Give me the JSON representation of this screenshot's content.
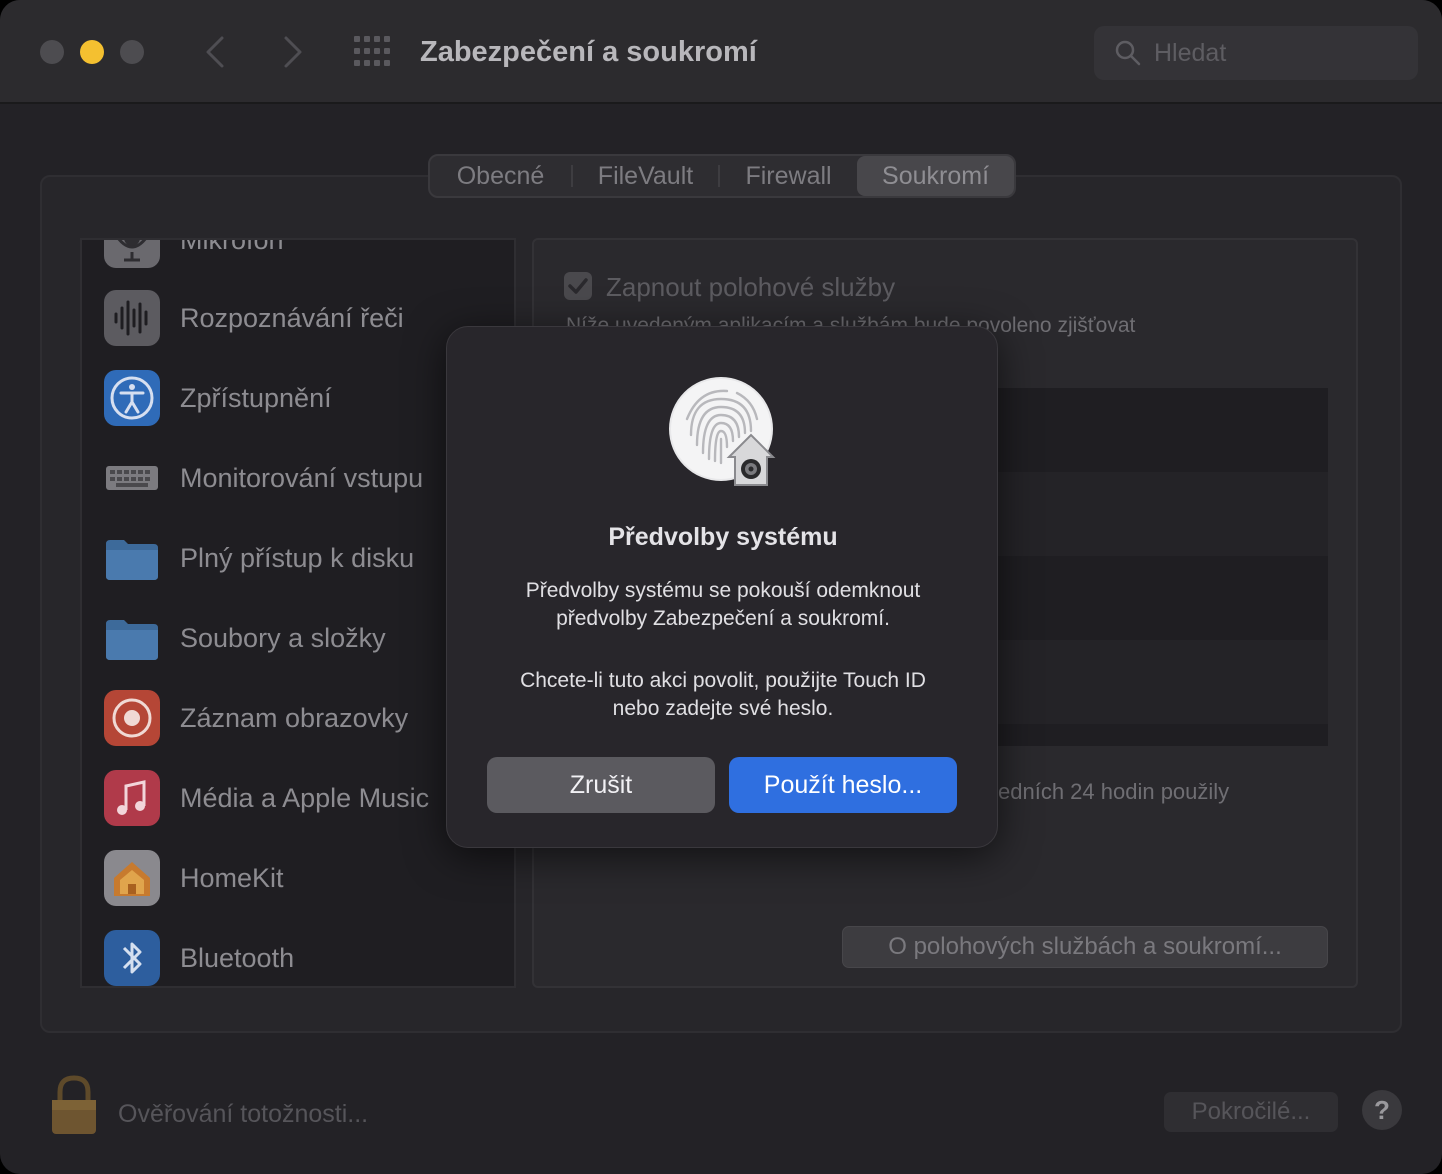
{
  "window": {
    "title": "Zabezpečení a soukromí",
    "search_placeholder": "Hledat"
  },
  "tabs": [
    {
      "label": "Obecné"
    },
    {
      "label": "FileVault"
    },
    {
      "label": "Firewall"
    },
    {
      "label": "Soukromí",
      "selected": true
    }
  ],
  "sidebar": {
    "items": [
      {
        "label": "Mikrofon",
        "icon": "microphone-icon"
      },
      {
        "label": "Rozpoznávání řeči",
        "icon": "speech-waveform-icon"
      },
      {
        "label": "Zpřístupnění",
        "icon": "accessibility-icon"
      },
      {
        "label": "Monitorování vstupu",
        "icon": "keyboard-icon"
      },
      {
        "label": "Plný přístup k disku",
        "icon": "folder-icon"
      },
      {
        "label": "Soubory a složky",
        "icon": "folder-icon"
      },
      {
        "label": "Záznam obrazovky",
        "icon": "screen-record-icon"
      },
      {
        "label": "Média a Apple Music",
        "icon": "music-note-icon"
      },
      {
        "label": "HomeKit",
        "icon": "home-icon"
      },
      {
        "label": "Bluetooth",
        "icon": "bluetooth-icon"
      }
    ]
  },
  "location": {
    "enable_label": "Zapnout polohové služby",
    "enabled": true,
    "description": "Níže uvedeným aplikacím a službám bude povoleno zjišťovat",
    "recent_text": "edních 24 hodin použily",
    "about_button": "O polohových službách a soukromí..."
  },
  "footer": {
    "lock_text": "Ověřování totožnosti...",
    "advanced_button": "Pokročilé...",
    "help_button": "?"
  },
  "dialog": {
    "title": "Předvolby systému",
    "message_line1": "Předvolby systému se pokouší odemknout",
    "message_line2": "předvolby Zabezpečení a soukromí.",
    "message2_line1": "Chcete-li tuto akci povolit, použijte Touch ID",
    "message2_line2": "nebo zadejte své heslo.",
    "cancel_button": "Zrušit",
    "primary_button": "Použít heslo..."
  },
  "colors": {
    "accent": "#2f6fe0",
    "traffic_yellow": "#f4c030"
  }
}
